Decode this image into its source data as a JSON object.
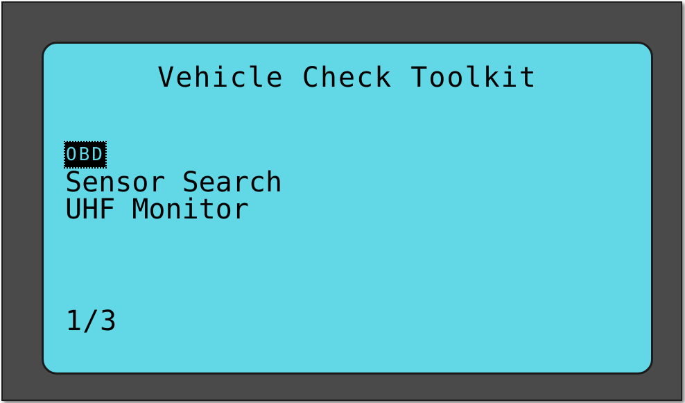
{
  "screen": {
    "title": "Vehicle Check Toolkit",
    "page_indicator": "1/3"
  },
  "menu": {
    "items": [
      {
        "label": "OBD",
        "selected": true
      },
      {
        "label": "Sensor Search",
        "selected": false
      },
      {
        "label": "UHF Monitor",
        "selected": false
      }
    ]
  },
  "colors": {
    "lcd_background": "#62d8e6",
    "device_bezel": "#4a4a4b",
    "text": "#000000"
  }
}
